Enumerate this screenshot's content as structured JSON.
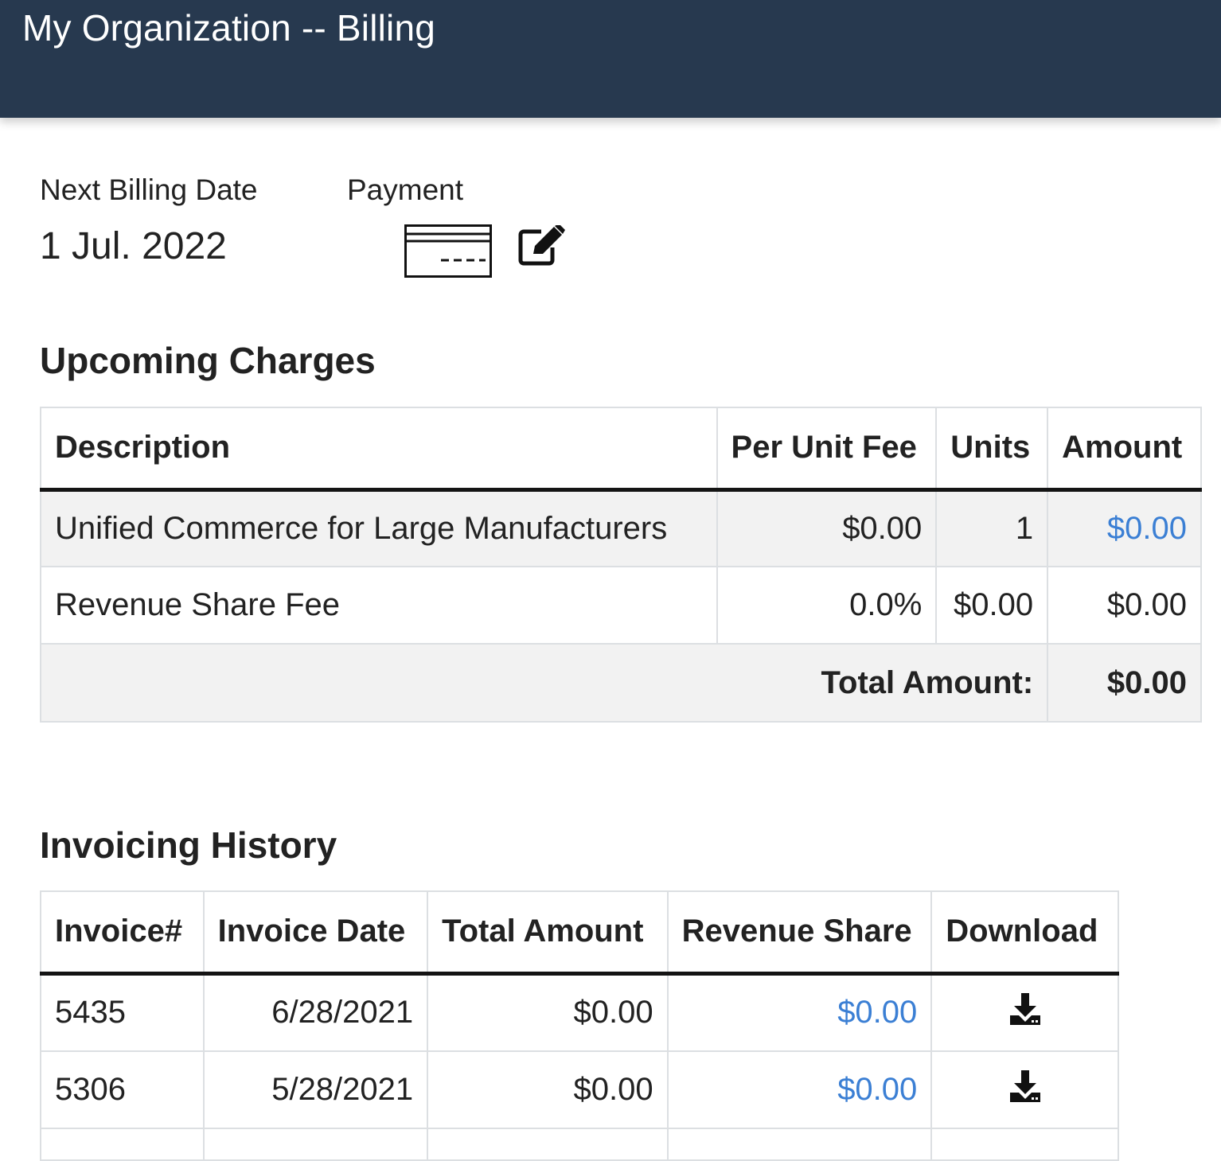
{
  "header": {
    "title": "My Organization -- Billing"
  },
  "billing": {
    "next_billing_label": "Next Billing Date",
    "next_billing_value": "1 Jul. 2022",
    "payment_label": "Payment",
    "card_icon": "credit-card-icon",
    "edit_icon": "edit-icon"
  },
  "upcoming": {
    "title": "Upcoming Charges",
    "columns": [
      "Description",
      "Per Unit Fee",
      "Units",
      "Amount"
    ],
    "rows": [
      {
        "description": "Unified Commerce for Large Manufacturers",
        "per_unit_fee": "$0.00",
        "units": "1",
        "amount": "$0.00"
      },
      {
        "description": "Revenue Share Fee",
        "per_unit_fee": "0.0%",
        "units": "$0.00",
        "amount": "$0.00"
      }
    ],
    "total_label": "Total Amount:",
    "total_value": "$0.00"
  },
  "history": {
    "title": "Invoicing History",
    "columns": [
      "Invoice#",
      "Invoice Date",
      "Total Amount",
      "Revenue Share",
      "Download"
    ],
    "rows": [
      {
        "invoice": "5435",
        "date": "6/28/2021",
        "total": "$0.00",
        "revenue_share": "$0.00",
        "download_icon": "download-icon"
      },
      {
        "invoice": "5306",
        "date": "5/28/2021",
        "total": "$0.00",
        "revenue_share": "$0.00",
        "download_icon": "download-icon"
      }
    ]
  },
  "colors": {
    "header_bg": "#27394f",
    "link_blue": "#3b7fd4",
    "row_shade": "#f2f2f2"
  }
}
